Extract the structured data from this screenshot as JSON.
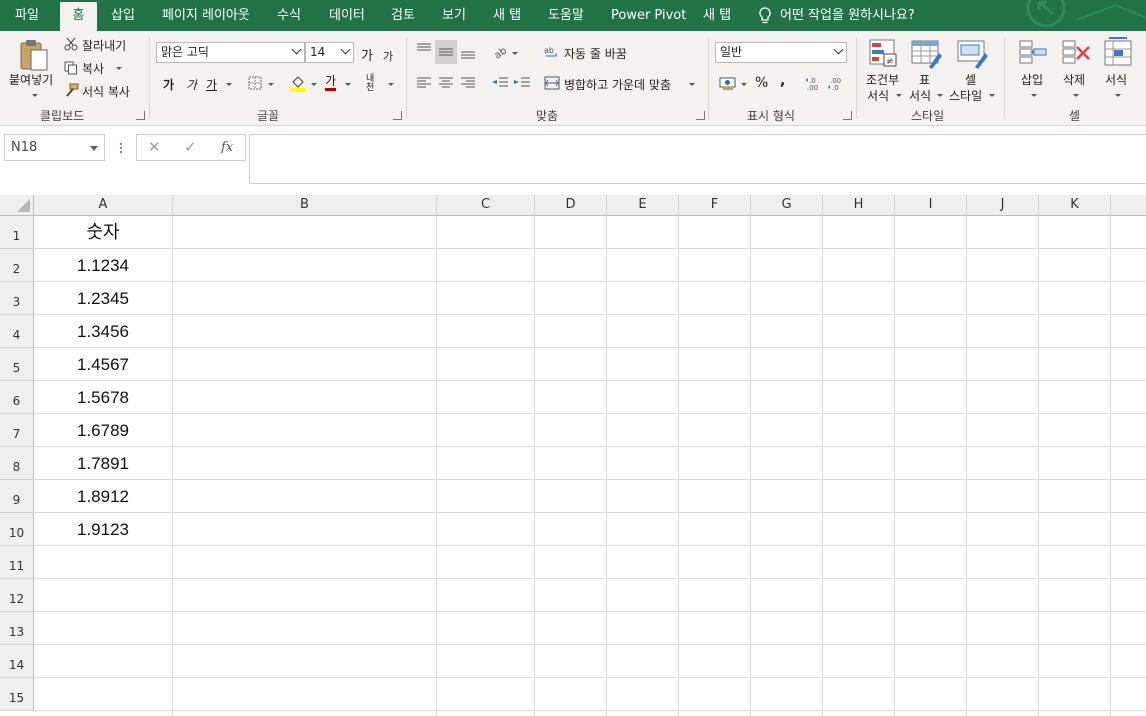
{
  "tabs": [
    "파일",
    "홈",
    "삽입",
    "페이지 레이아웃",
    "수식",
    "데이터",
    "검토",
    "보기",
    "새 탭",
    "도움말",
    "Power Pivot",
    "새 탭"
  ],
  "active_tab": "홈",
  "tell_me": "어떤 작업을 원하시나요?",
  "clipboard": {
    "paste": "붙여넣기",
    "cut": "잘라내기",
    "copy": "복사",
    "format_painter": "서식 복사",
    "label": "클립보드"
  },
  "font": {
    "name": "맑은 고딕",
    "size": "14",
    "bold": "가",
    "italic": "가",
    "underline": "가",
    "grow": "가",
    "shrink": "가",
    "color_btn": "가",
    "phonetic": "내천",
    "label": "글꼴"
  },
  "alignment": {
    "wrap": "자동 줄 바꿈",
    "merge": "병합하고 가운데 맞춤",
    "label": "맞춤"
  },
  "number": {
    "format": "일반",
    "percent": "%",
    "comma": ",",
    "label": "표시 형식"
  },
  "styles": {
    "conditional": [
      "조건부",
      "서식"
    ],
    "table": [
      "표",
      "서식"
    ],
    "cell": [
      "셀",
      "스타일"
    ],
    "label": "스타일"
  },
  "cells": {
    "insert": "삽입",
    "delete": "삭제",
    "format": "서식",
    "label": "셀"
  },
  "formula": {
    "namebox": "N18",
    "cancel": "✕",
    "enter": "✓",
    "fx": "fx",
    "content": ""
  },
  "columns": [
    "A",
    "B",
    "C",
    "D",
    "E",
    "F",
    "G",
    "H",
    "I",
    "J",
    "K"
  ],
  "rows": [
    "1",
    "2",
    "3",
    "4",
    "5",
    "6",
    "7",
    "8",
    "9",
    "10",
    "11",
    "12",
    "13",
    "14",
    "15"
  ],
  "column_a": [
    "숫자",
    "1.1234",
    "1.2345",
    "1.3456",
    "1.4567",
    "1.5678",
    "1.6789",
    "1.7891",
    "1.8912",
    "1.9123"
  ],
  "colors": {
    "ribbon_green": "#217346",
    "ribbon_bg": "#f3f2f1",
    "header_bg": "#efefef",
    "gridline": "#dadada"
  }
}
